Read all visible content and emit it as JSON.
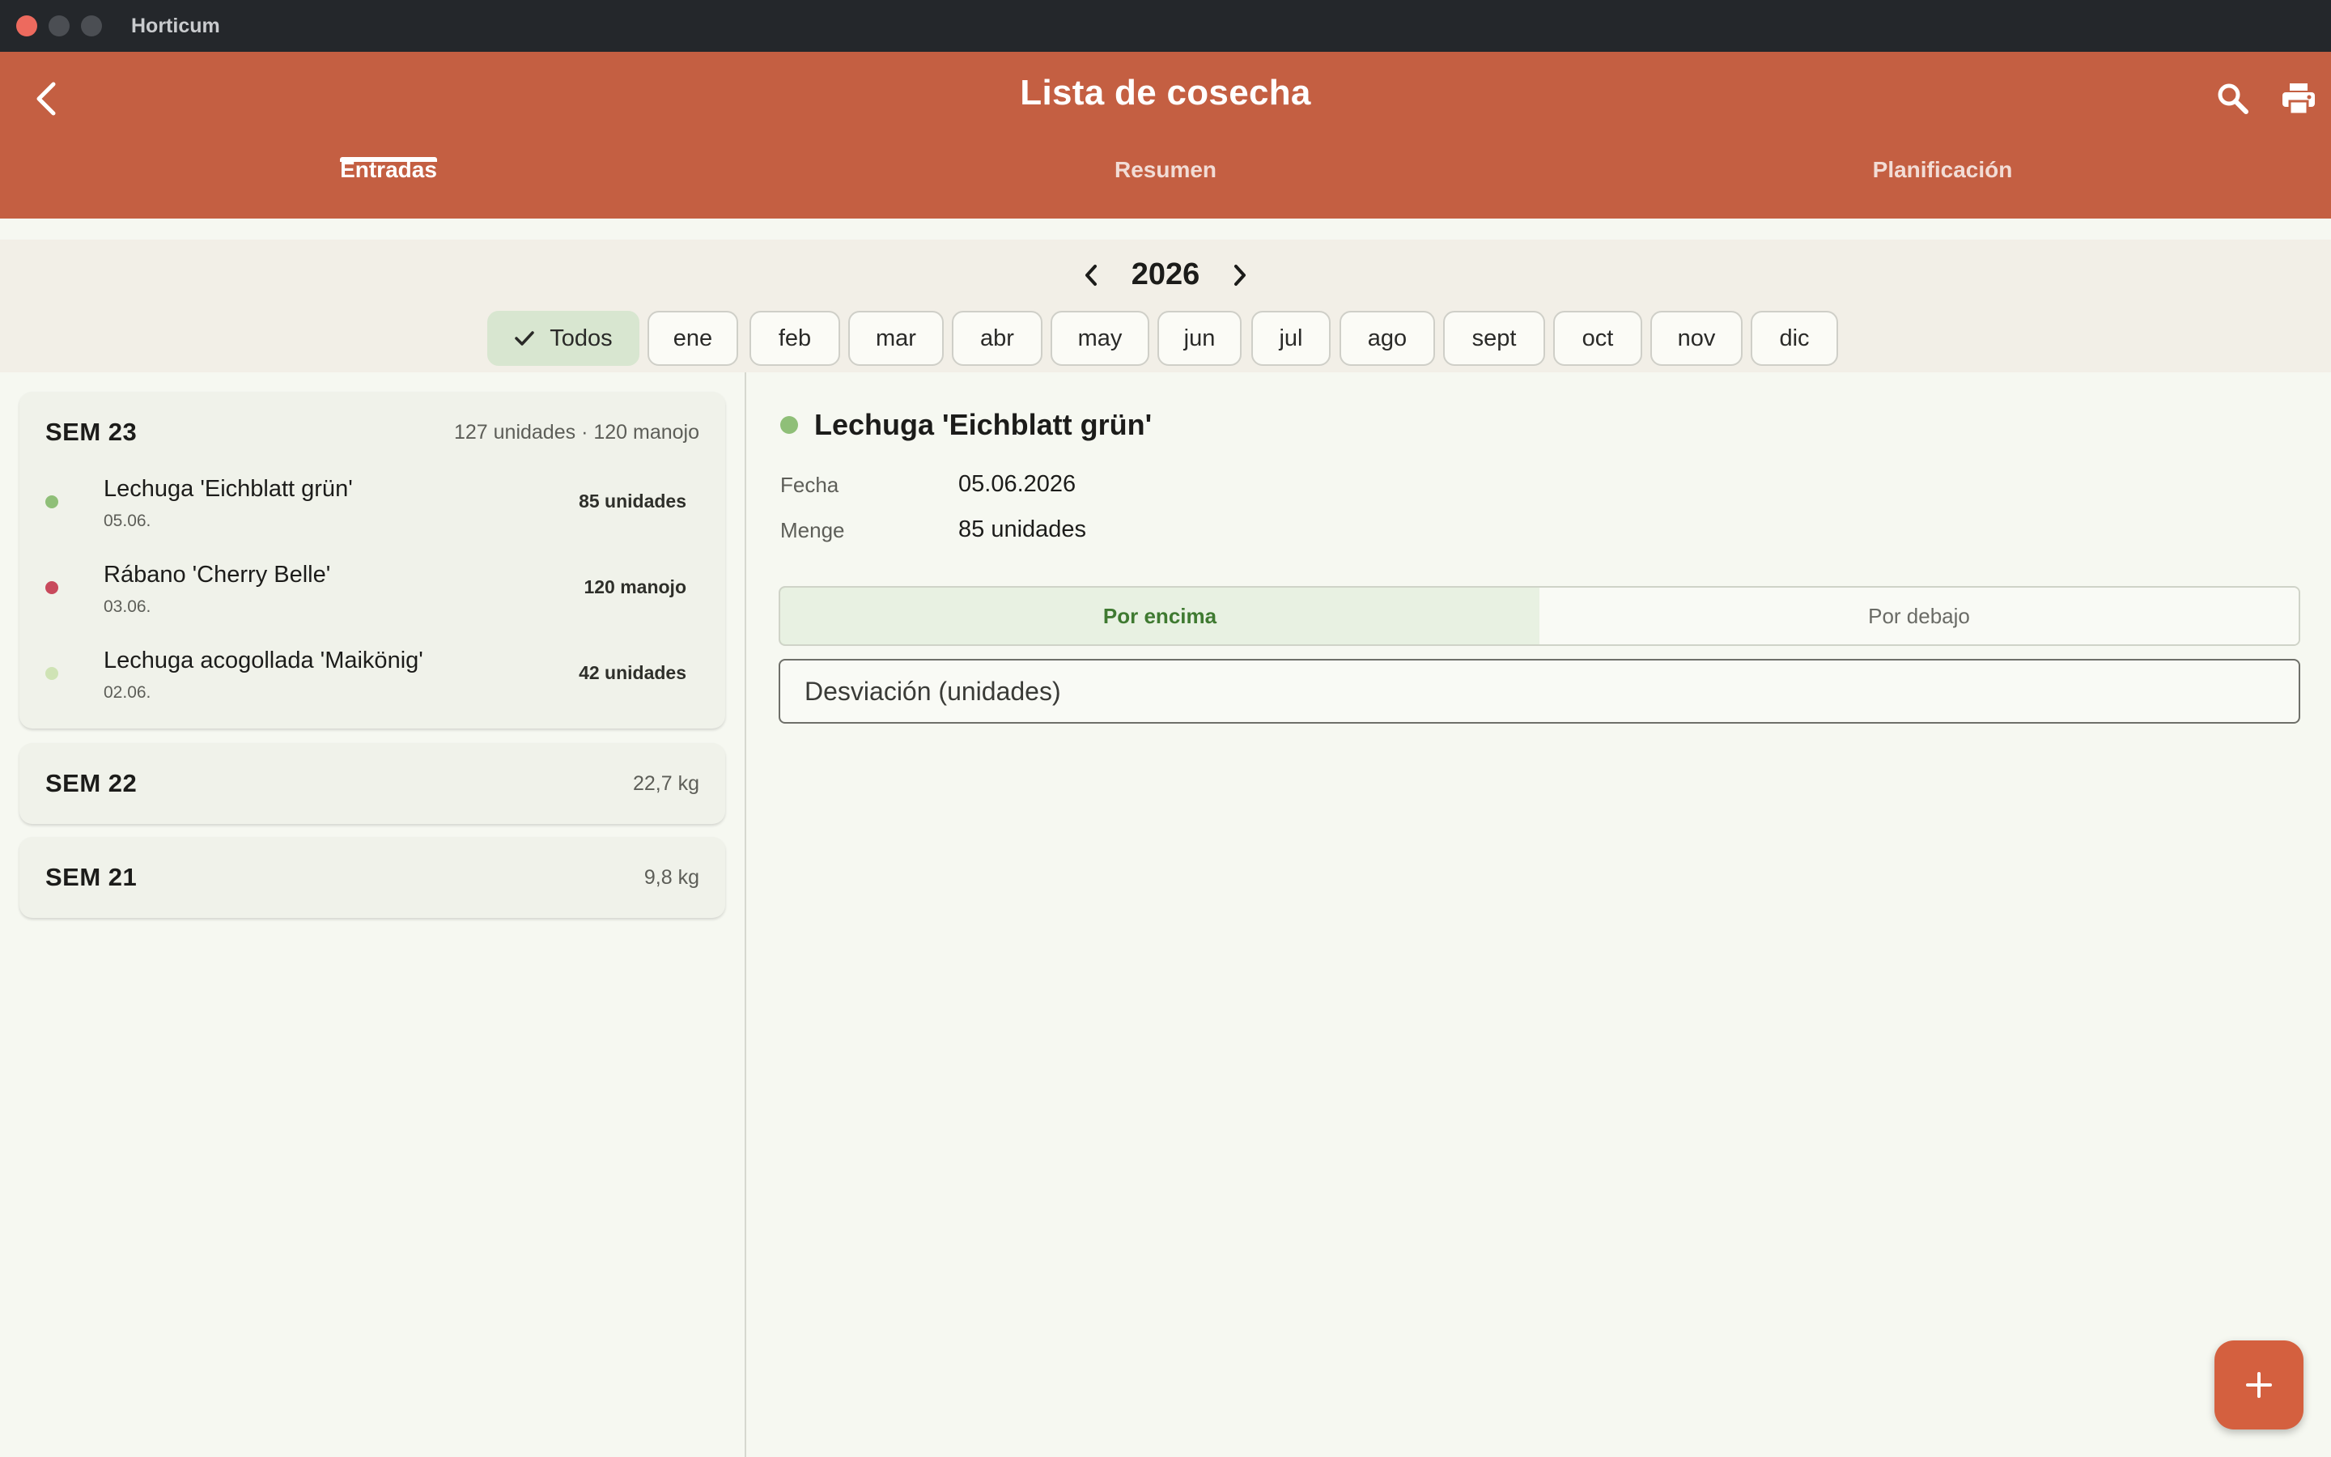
{
  "window": {
    "app_title": "Horticum"
  },
  "appbar": {
    "title": "Lista de cosecha",
    "icons": [
      "back-arrow-icon",
      "search-icon",
      "print-icon"
    ],
    "background_color": "#c45f42"
  },
  "tabs": [
    {
      "label": "Entradas",
      "active": true
    },
    {
      "label": "Resumen",
      "active": false
    },
    {
      "label": "Planificación",
      "active": false
    }
  ],
  "filter": {
    "year": "2026",
    "chips": [
      {
        "label": "Todos",
        "selected": true
      },
      {
        "label": "ene",
        "selected": false
      },
      {
        "label": "feb",
        "selected": false
      },
      {
        "label": "mar",
        "selected": false
      },
      {
        "label": "abr",
        "selected": false
      },
      {
        "label": "may",
        "selected": false
      },
      {
        "label": "jun",
        "selected": false
      },
      {
        "label": "jul",
        "selected": false
      },
      {
        "label": "ago",
        "selected": false
      },
      {
        "label": "sept",
        "selected": false
      },
      {
        "label": "oct",
        "selected": false
      },
      {
        "label": "nov",
        "selected": false
      },
      {
        "label": "dic",
        "selected": false
      }
    ]
  },
  "weeks": [
    {
      "label": "SEM 23",
      "summary": "127 unidades · 120 manojo",
      "expanded": true,
      "entries": [
        {
          "name": "Lechuga 'Eichblatt grün'",
          "date": "05.06.",
          "qty": "85 unidades",
          "color": "#8fbf78"
        },
        {
          "name": "Rábano 'Cherry Belle'",
          "date": "03.06.",
          "qty": "120 manojo",
          "color": "#c84a5c"
        },
        {
          "name": "Lechuga acogollada 'Maikönig'",
          "date": "02.06.",
          "qty": "42 unidades",
          "color": "#cfe3b5"
        }
      ]
    },
    {
      "label": "SEM 22",
      "summary": "22,7 kg",
      "expanded": false,
      "entries": []
    },
    {
      "label": "SEM 21",
      "summary": "9,8 kg",
      "expanded": false,
      "entries": []
    }
  ],
  "detail": {
    "title": "Lechuga 'Eichblatt grün'",
    "dot_color": "#8fbf78",
    "fields": [
      {
        "label": "Fecha",
        "value": "05.06.2026"
      },
      {
        "label": "Menge",
        "value": "85 unidades"
      }
    ],
    "segments": [
      {
        "label": "Por encima",
        "active": true
      },
      {
        "label": "Por debajo",
        "active": false
      }
    ],
    "input_placeholder": "Desviación (unidades)"
  },
  "fab": {
    "icon": "plus-icon"
  }
}
